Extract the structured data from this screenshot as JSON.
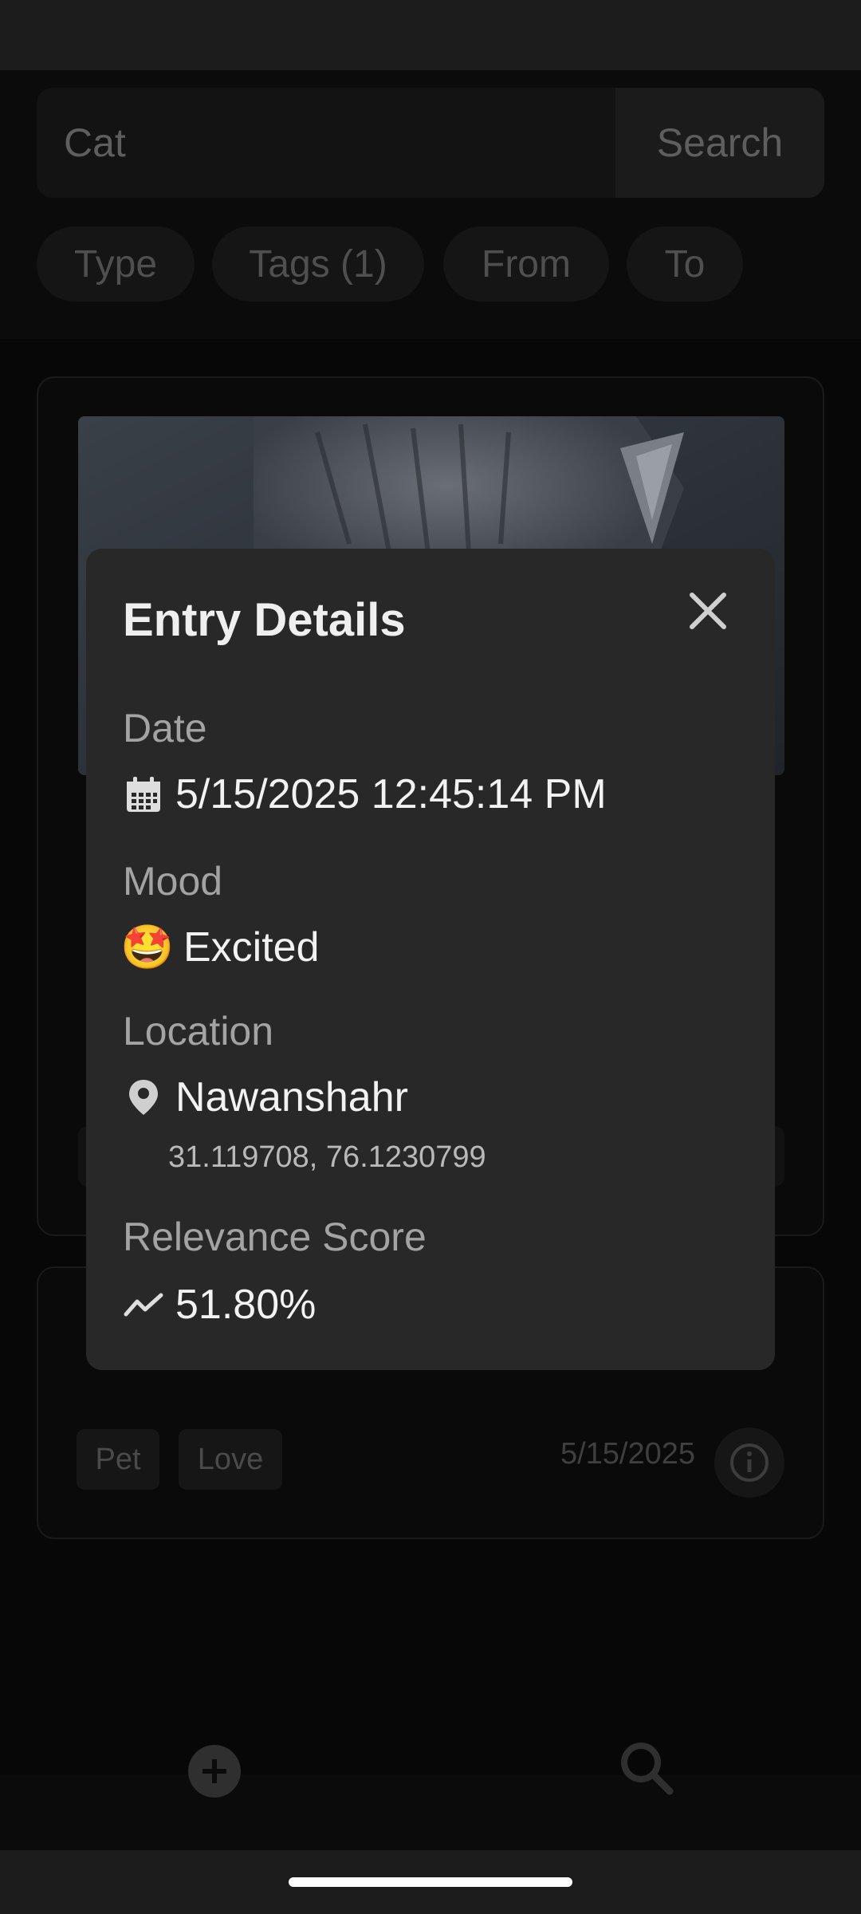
{
  "search": {
    "value": "Cat",
    "button_label": "Search"
  },
  "filters": [
    "Type",
    "Tags (1)",
    "From",
    "To"
  ],
  "second_card": {
    "tags": [
      "Pet",
      "Love"
    ],
    "date": "5/15/2025"
  },
  "dialog": {
    "title": "Entry Details",
    "date_label": "Date",
    "date_value": "5/15/2025 12:45:14 PM",
    "mood_label": "Mood",
    "mood_emoji": "🤩",
    "mood_value": "Excited",
    "location_label": "Location",
    "location_name": "Nawanshahr",
    "location_coords": "31.119708, 76.1230799",
    "relevance_label": "Relevance Score",
    "relevance_value": "51.80%"
  },
  "icons": {
    "calendar": "calendar-icon",
    "location": "location-pin-icon",
    "relevance": "trend-icon",
    "close": "close-icon",
    "add": "add-icon",
    "search": "search-icon",
    "info": "info-icon"
  }
}
